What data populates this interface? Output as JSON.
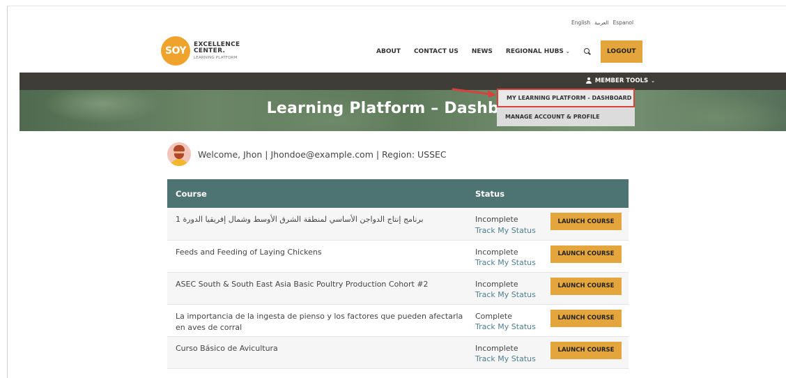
{
  "languages": [
    "English",
    "العربية",
    "Espanol"
  ],
  "logo": {
    "mark": "SOY",
    "line1": "EXCELLENCE",
    "line2": "CENTER.",
    "line3": "LEARNING PLATFORM"
  },
  "nav": {
    "about": "ABOUT",
    "contact": "CONTACT US",
    "news": "NEWS",
    "regional_hubs": "REGIONAL HUBS",
    "logout": "LOGOUT"
  },
  "member_tools": {
    "label": "MEMBER TOOLS",
    "menu": [
      "MY LEARNING PLATFORM - DASHBOARD",
      "MANAGE ACCOUNT & PROFILE"
    ]
  },
  "banner": {
    "title": "Learning Platform – Dashboard"
  },
  "welcome": {
    "text": "Welcome, Jhon | Jhondoe@example.com | Region: USSEC"
  },
  "table": {
    "headers": {
      "course": "Course",
      "status": "Status"
    },
    "launch_label": "LAUNCH COURSE",
    "track_label": "Track My Status",
    "rows": [
      {
        "course": "برنامج إنتاج الدواجن الأساسي لمنطقة الشرق الأوسط وشمال إفريقيا الدورة 1",
        "status": "Incomplete"
      },
      {
        "course": "Feeds and Feeding of Laying Chickens",
        "status": "Incomplete"
      },
      {
        "course": "ASEC South & South East Asia Basic Poultry Production Cohort #2",
        "status": "Incomplete"
      },
      {
        "course": "La importancia de la ingesta de pienso y los factores que pueden afectarla en aves de corral",
        "status": "Complete"
      },
      {
        "course": "Curso Básico de Avicultura",
        "status": "Incomplete"
      }
    ]
  },
  "colors": {
    "accent": "#e4a63c",
    "table_header": "#4e7373",
    "toolbar": "#3e3d37",
    "highlight": "#d9423c",
    "link": "#4e7f8f"
  }
}
